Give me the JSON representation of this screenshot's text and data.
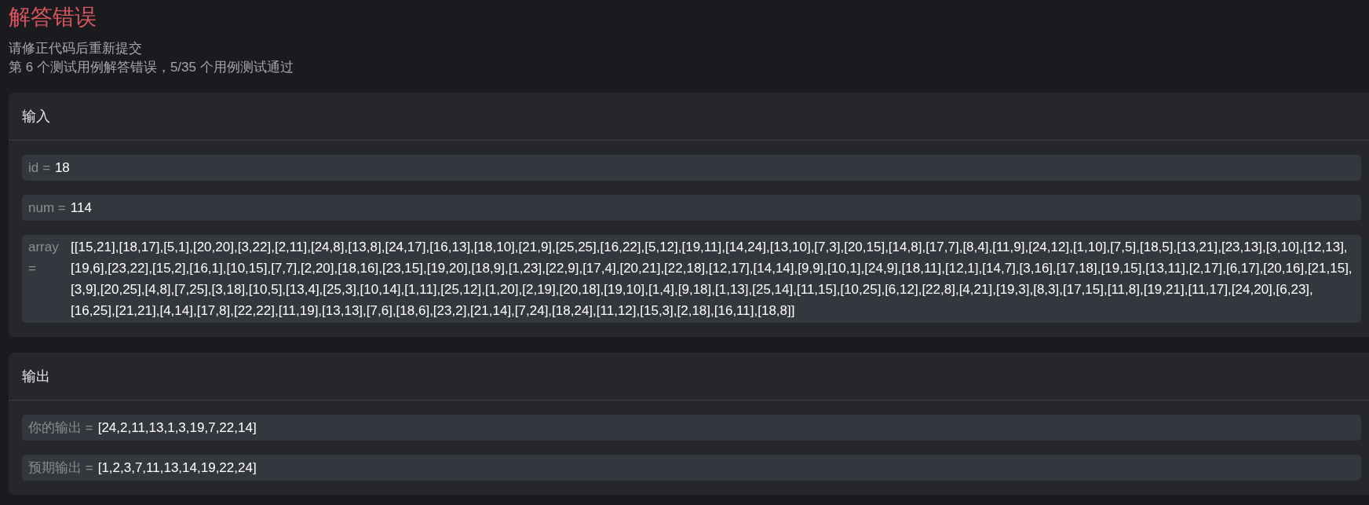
{
  "title": "解答错误",
  "messages": [
    "请修正代码后重新提交",
    "第 6 个测试用例解答错误，5/35 个用例测试通过"
  ],
  "sections": [
    {
      "title": "输入",
      "params": [
        {
          "kind": "inline",
          "name": "id =",
          "value": "18"
        },
        {
          "kind": "inline",
          "name": "num =",
          "value": "114"
        },
        {
          "kind": "block",
          "name": "array =",
          "value": "[[15,21],[18,17],[5,1],[20,20],[3,22],[2,11],[24,8],[13,8],[24,17],[16,13],[18,10],[21,9],[25,25],[16,22],[5,12],[19,11],[14,24],[13,10],[7,3],[20,15],[14,8],[17,7],[8,4],[11,9],[24,12],[1,10],[7,5],[18,5],[13,21],[23,13],[3,10],[12,13],[19,6],[23,22],[15,2],[16,1],[10,15],[7,7],[2,20],[18,16],[23,15],[19,20],[18,9],[1,23],[22,9],[17,4],[20,21],[22,18],[12,17],[14,14],[9,9],[10,1],[24,9],[18,11],[12,1],[14,7],[3,16],[17,18],[19,15],[13,11],[2,17],[6,17],[20,16],[21,15],[3,9],[20,25],[4,8],[7,25],[3,18],[10,5],[13,4],[25,3],[10,14],[1,11],[25,12],[1,20],[2,19],[20,18],[19,10],[1,4],[9,18],[1,13],[25,14],[11,15],[10,25],[6,12],[22,8],[4,21],[19,3],[8,3],[17,15],[11,8],[19,21],[11,17],[24,20],[6,23],[16,25],[21,21],[4,14],[17,8],[22,22],[11,19],[13,13],[7,6],[18,6],[23,2],[21,14],[7,24],[18,24],[11,12],[15,3],[2,18],[16,11],[18,8]]"
        }
      ]
    },
    {
      "title": "输出",
      "params": [
        {
          "kind": "inline",
          "name": "你的输出 =",
          "value": "[24,2,11,13,1,3,19,7,22,14]"
        },
        {
          "kind": "inline",
          "name": "预期输出 =",
          "value": "[1,2,3,7,11,13,14,19,22,24]"
        }
      ]
    }
  ]
}
